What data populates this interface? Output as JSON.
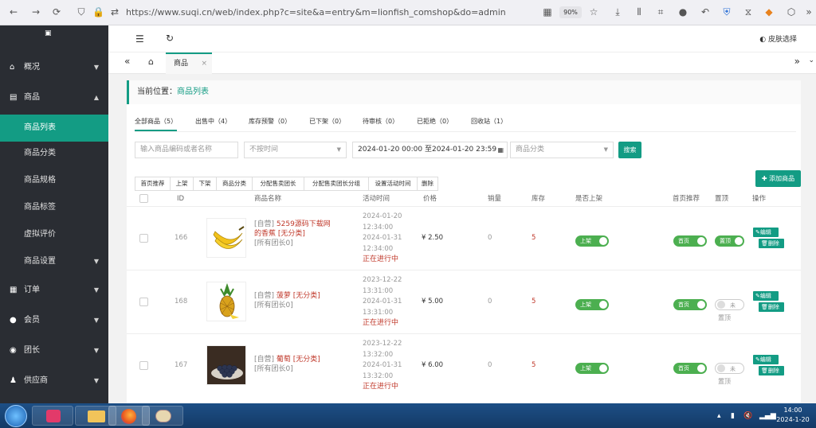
{
  "browser": {
    "url": "https://www.suqi.cn/web/index.php?c=site&a=entry&m=lionfish_comshop&do=admin",
    "zoom": "90%"
  },
  "sidebar": {
    "items": [
      {
        "label": "概况",
        "icon": "home-icon",
        "expanded": false
      },
      {
        "label": "商品",
        "icon": "box-icon",
        "expanded": true
      },
      {
        "label": "订单",
        "icon": "order-icon",
        "expanded": false
      },
      {
        "label": "会员",
        "icon": "users-icon",
        "expanded": false
      },
      {
        "label": "团长",
        "icon": "leader-icon",
        "expanded": false
      },
      {
        "label": "供应商",
        "icon": "supplier-icon",
        "expanded": false
      }
    ],
    "sub": [
      {
        "label": "商品列表",
        "active": true
      },
      {
        "label": "商品分类"
      },
      {
        "label": "商品规格"
      },
      {
        "label": "商品标签"
      },
      {
        "label": "虚拟评价"
      },
      {
        "label": "商品设置"
      }
    ]
  },
  "topbar": {
    "skin_label": "皮肤选择"
  },
  "tabbar": {
    "tab_label": "商品",
    "close": "×"
  },
  "breadcrumb": {
    "prefix": "当前位置：",
    "current": "商品列表"
  },
  "status_tabs": [
    {
      "label": "全部商品（5）",
      "active": true
    },
    {
      "label": "出售中（4）"
    },
    {
      "label": "库存预警（0）"
    },
    {
      "label": "已下架（0）"
    },
    {
      "label": "待审核（0）"
    },
    {
      "label": "已拒绝（0）"
    },
    {
      "label": "回收站（1）"
    }
  ],
  "filters": {
    "search_placeholder": "输入商品编码或者名称",
    "time_select": "不按时间",
    "date_range": "2024-01-20 00:00 至2024-01-20 23:59",
    "category_select": "商品分类",
    "search_button": "搜索"
  },
  "batch_buttons": [
    "首页推荐",
    "上架",
    "下架",
    "商品分类",
    "分配售卖团长",
    "分配售卖团长分组",
    "设置活动时间",
    "删除"
  ],
  "add_button": "添加商品",
  "table": {
    "headers": [
      "ID",
      "商品名称",
      "活动时间",
      "价格",
      "销量",
      "库存",
      "是否上架",
      "首页推荐",
      "置顶",
      "操作"
    ],
    "rows": [
      {
        "id": "166",
        "owner": "[自营]",
        "name": "5259源码下载网的香蕉 [无分类]",
        "group": "[所有团长0]",
        "start": "2024-01-20",
        "start_time": "12:34:00",
        "end": "2024-01-31",
        "end_time": "12:34:00",
        "status": "正在进行中",
        "price": "¥ 2.50",
        "sales": "0",
        "stock": "5",
        "onshelf": "上架",
        "recommend": "首页",
        "top": "置顶",
        "top_on": true,
        "image": "banana"
      },
      {
        "id": "168",
        "owner": "[自营]",
        "name": "菠萝 [无分类]",
        "group": "[所有团长0]",
        "start": "2023-12-22",
        "start_time": "13:31:00",
        "end": "2024-01-31",
        "end_time": "13:31:00",
        "status": "正在进行中",
        "price": "¥ 5.00",
        "sales": "0",
        "stock": "5",
        "onshelf": "上架",
        "recommend": "首页",
        "top": "未",
        "top_sub": "置顶",
        "top_on": false,
        "image": "pineapple"
      },
      {
        "id": "167",
        "owner": "[自营]",
        "name": "葡萄 [无分类]",
        "group": "[所有团长0]",
        "start": "2023-12-22",
        "start_time": "13:32:00",
        "end": "2024-01-31",
        "end_time": "13:32:00",
        "status": "正在进行中",
        "price": "¥ 6.00",
        "sales": "0",
        "stock": "5",
        "onshelf": "上架",
        "recommend": "首页",
        "top": "未",
        "top_sub": "置顶",
        "top_on": false,
        "image": "grape"
      }
    ],
    "edit_label": "编辑",
    "delete_label": "删除"
  },
  "taskbar": {
    "time": "14:00",
    "date": "2024-1-20"
  }
}
